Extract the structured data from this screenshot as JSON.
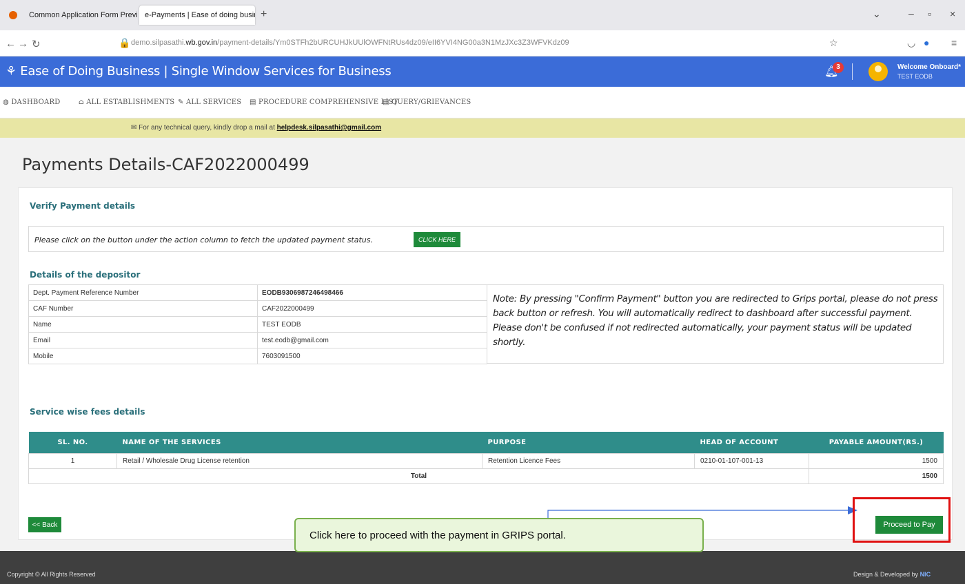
{
  "browser": {
    "tab1_title": "Common Application Form Previe",
    "tab2_title": "e-Payments | Ease of doing business",
    "url_prefix": "demo.silpasathi.",
    "url_domain": "wb.gov.in",
    "url_path": "/payment-details/Ym0STFh2bURCUHJkUUlOWFNtRUs4dz09/eII6YVI4NG00a3N1MzJXc3Z3WFVKdz09"
  },
  "header": {
    "title": "Ease of Doing Business | Single Window Services for Business",
    "notification_count": "3",
    "welcome": "Welcome Onboard*",
    "user": "TEST EODB"
  },
  "menu": {
    "dashboard": "DASHBOARD",
    "establishments": "ALL ESTABLISHMENTS",
    "services": "ALL SERVICES",
    "procedure": "PROCEDURE COMPREHENSIVE LIST",
    "query": "QUERY/GRIEVANCES"
  },
  "notice": {
    "text": "For any technical query, kindly drop a mail at ",
    "email": "helpdesk.silpasathi@gmail.com"
  },
  "page": {
    "title": "Payments Details-CAF2022000499",
    "verify_heading": "Verify Payment details",
    "verify_text": "Please click on the button under the action column to fetch the updated payment status.",
    "click_here": "CLICK HERE",
    "depositor_heading": "Details of the depositor",
    "depositor": [
      {
        "key": "Dept. Payment Reference Number",
        "value": "EODB9306987246498466"
      },
      {
        "key": "CAF Number",
        "value": "CAF2022000499"
      },
      {
        "key": "Name",
        "value": "TEST EODB"
      },
      {
        "key": "Email",
        "value": "test.eodb@gmail.com"
      },
      {
        "key": "Mobile",
        "value": "7603091500"
      }
    ],
    "note": "Note: By pressing \"Confirm Payment\" button you are redirected to Grips portal, please do not press back button or refresh. You will automatically redirect to dashboard after successful payment. Please don't be confused if not redirected automatically, your payment status will be updated shortly.",
    "fees_heading": "Service wise fees details",
    "fees_headers": [
      "SL. NO.",
      "NAME OF THE SERVICES",
      "PURPOSE",
      "HEAD OF ACCOUNT",
      "PAYABLE AMOUNT(RS.)"
    ],
    "fees_rows": [
      {
        "sl": "1",
        "service": "Retail / Wholesale Drug License retention",
        "purpose": "Retention Licence Fees",
        "head": "0210-01-107-001-13",
        "amount": "1500"
      }
    ],
    "total_label": "Total",
    "total_amount": "1500",
    "back": "<< Back",
    "proceed": "Proceed to Pay"
  },
  "annotation": {
    "callout": "Click here to proceed with the payment in GRIPS portal.",
    "highlight_color": "#e01010",
    "arrow_color": "#3b6cd8"
  },
  "footer": {
    "copyright": "Copyright © All Rights Reserved",
    "design": "Design & Developed by ",
    "brand": "NIC"
  }
}
